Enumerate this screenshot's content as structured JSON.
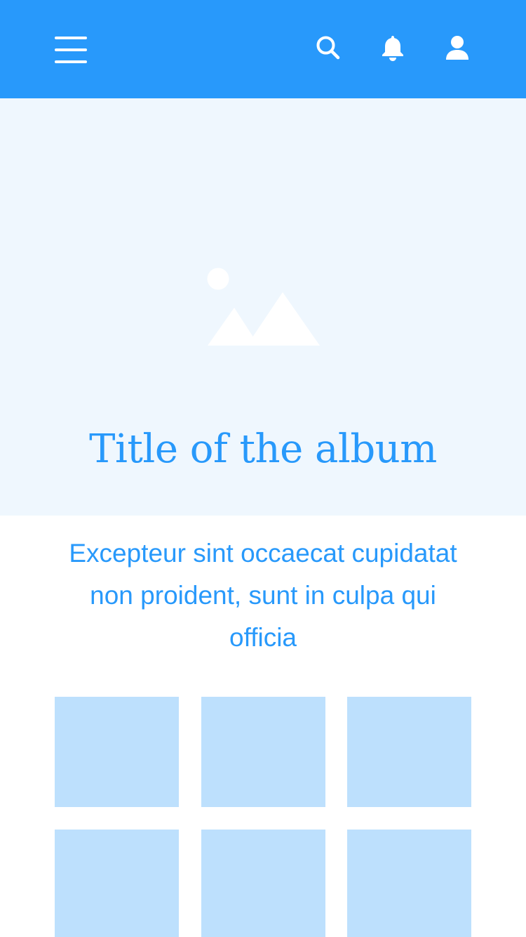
{
  "appbar": {
    "background": "#2899fb",
    "icons": {
      "menu": "menu-icon",
      "search": "search-icon",
      "notifications": "bell-icon",
      "profile": "user-icon"
    }
  },
  "hero": {
    "background": "#eff7fe",
    "image": "image-placeholder-icon",
    "title": "Title of the album"
  },
  "description": "Excepteur sint occaecat cupidatat non proident, sunt in culpa qui officia",
  "colors": {
    "primary": "#2899fb",
    "thumb": "#bde0fd",
    "hero": "#eff7fe"
  },
  "gallery": {
    "items": [
      "photo",
      "photo",
      "photo",
      "photo",
      "photo",
      "photo"
    ]
  }
}
